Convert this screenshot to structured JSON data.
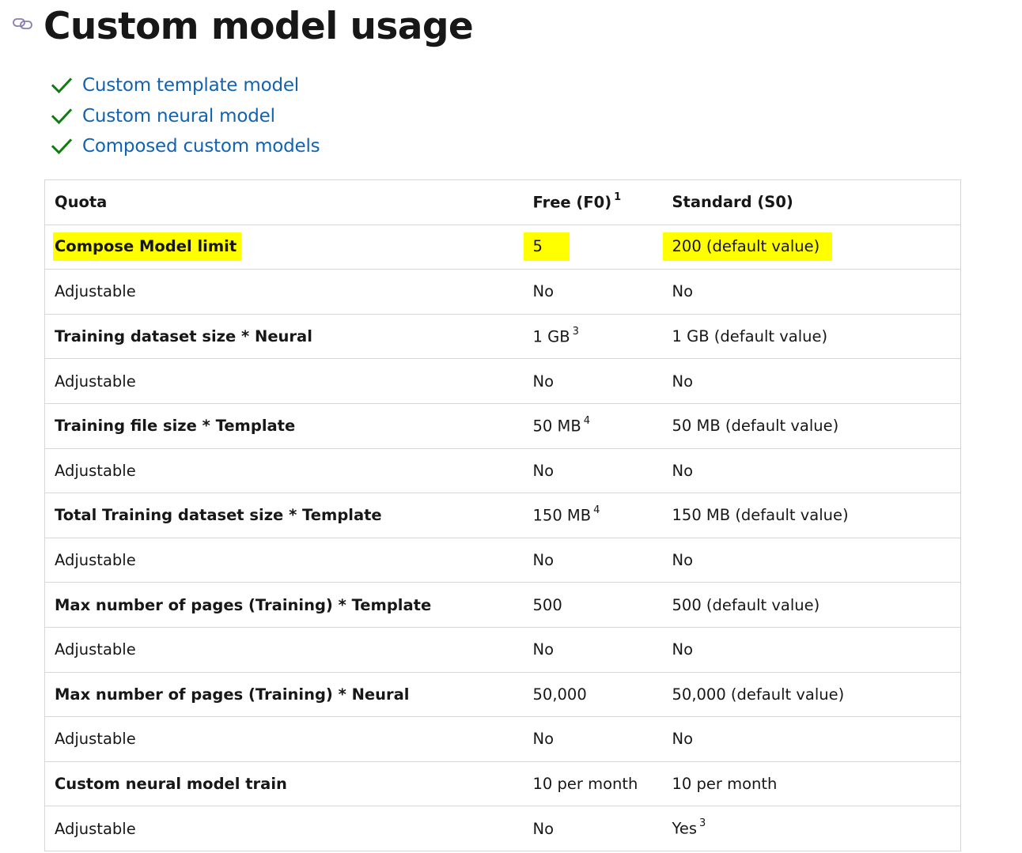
{
  "heading": {
    "title": "Custom model usage",
    "anchor_icon": "link-icon"
  },
  "models": [
    {
      "label": "Custom template model",
      "icon": "check-icon"
    },
    {
      "label": "Custom neural model",
      "icon": "check-icon"
    },
    {
      "label": "Composed custom models",
      "icon": "check-icon"
    }
  ],
  "colors": {
    "link": "#1162b0",
    "check": "#107c10",
    "highlight": "#ffff00",
    "border": "#d6d6d6"
  },
  "table": {
    "headers": {
      "quota": "Quota",
      "free": "Free (F0)",
      "free_sup": "1",
      "standard": "Standard (S0)"
    },
    "rows": [
      {
        "quota": "Compose Model limit",
        "free": "5",
        "free_sup": "",
        "standard": "200 (default value)",
        "standard_sup": ""
      },
      {
        "quota": "Adjustable",
        "free": "No",
        "free_sup": "",
        "standard": "No",
        "standard_sup": ""
      },
      {
        "quota": "Training dataset size * Neural",
        "free": "1 GB",
        "free_sup": "3",
        "standard": "1 GB (default value)",
        "standard_sup": ""
      },
      {
        "quota": "Adjustable",
        "free": "No",
        "free_sup": "",
        "standard": "No",
        "standard_sup": ""
      },
      {
        "quota": "Training file size * Template",
        "free": "50 MB",
        "free_sup": "4",
        "standard": "50 MB (default value)",
        "standard_sup": ""
      },
      {
        "quota": "Adjustable",
        "free": "No",
        "free_sup": "",
        "standard": "No",
        "standard_sup": ""
      },
      {
        "quota": "Total Training dataset size * Template",
        "free": "150 MB",
        "free_sup": "4",
        "standard": "150 MB (default value)",
        "standard_sup": ""
      },
      {
        "quota": "Adjustable",
        "free": "No",
        "free_sup": "",
        "standard": "No",
        "standard_sup": ""
      },
      {
        "quota": "Max number of pages (Training) * Template",
        "free": "500",
        "free_sup": "",
        "standard": "500 (default value)",
        "standard_sup": ""
      },
      {
        "quota": "Adjustable",
        "free": "No",
        "free_sup": "",
        "standard": "No",
        "standard_sup": ""
      },
      {
        "quota": "Max number of pages (Training) * Neural",
        "free": "50,000",
        "free_sup": "",
        "standard": "50,000 (default value)",
        "standard_sup": ""
      },
      {
        "quota": "Adjustable",
        "free": "No",
        "free_sup": "",
        "standard": "No",
        "standard_sup": ""
      },
      {
        "quota": "Custom neural model train",
        "free": "10 per month",
        "free_sup": "",
        "standard": "10 per month",
        "standard_sup": ""
      },
      {
        "quota": "Adjustable",
        "free": "No",
        "free_sup": "",
        "standard": "Yes",
        "standard_sup": "3"
      }
    ]
  }
}
